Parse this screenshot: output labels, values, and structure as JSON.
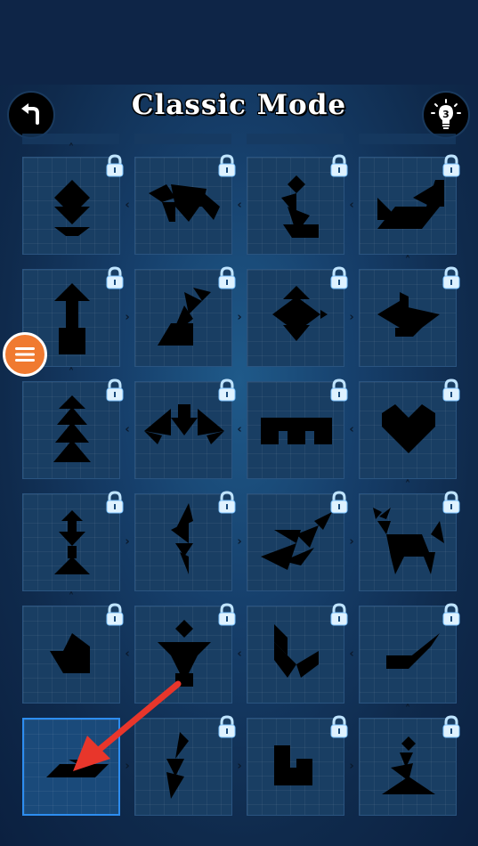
{
  "header": {
    "title": "Classic Mode",
    "hints_count": "3"
  },
  "icons": {
    "back": "back-arrow-icon",
    "hint": "lightbulb-icon",
    "menu": "hamburger-menu-icon",
    "lock": "padlock-icon"
  },
  "colors": {
    "accent_menu": "#f07a30",
    "selection_border": "#2d8df0",
    "pointer_arrow": "#e8362b"
  },
  "levels": {
    "rows": [
      [
        {
          "shape": "diamond-on-boat",
          "locked": true
        },
        {
          "shape": "crawling-animal",
          "locked": true
        },
        {
          "shape": "kneeling-figure",
          "locked": true
        },
        {
          "shape": "bird-on-ground",
          "locked": true
        }
      ],
      [
        {
          "shape": "arrow-post",
          "locked": true
        },
        {
          "shape": "sitting-cat",
          "locked": true
        },
        {
          "shape": "fish-diamond",
          "locked": true
        },
        {
          "shape": "boat",
          "locked": true
        }
      ],
      [
        {
          "shape": "pine-tree",
          "locked": true
        },
        {
          "shape": "bat",
          "locked": true
        },
        {
          "shape": "bridge",
          "locked": true
        },
        {
          "shape": "heart",
          "locked": true
        }
      ],
      [
        {
          "shape": "totem",
          "locked": true
        },
        {
          "shape": "leaf-figure",
          "locked": true
        },
        {
          "shape": "flying-bird",
          "locked": true
        },
        {
          "shape": "deer",
          "locked": true
        }
      ],
      [
        {
          "shape": "house",
          "locked": true
        },
        {
          "shape": "cup",
          "locked": true
        },
        {
          "shape": "hook",
          "locked": true
        },
        {
          "shape": "plane",
          "locked": true
        }
      ],
      [
        {
          "shape": "parallelogram-pair",
          "locked": false,
          "selected": true
        },
        {
          "shape": "zigzag",
          "locked": true
        },
        {
          "shape": "chair",
          "locked": true
        },
        {
          "shape": "sitting-person",
          "locked": true
        }
      ]
    ]
  }
}
